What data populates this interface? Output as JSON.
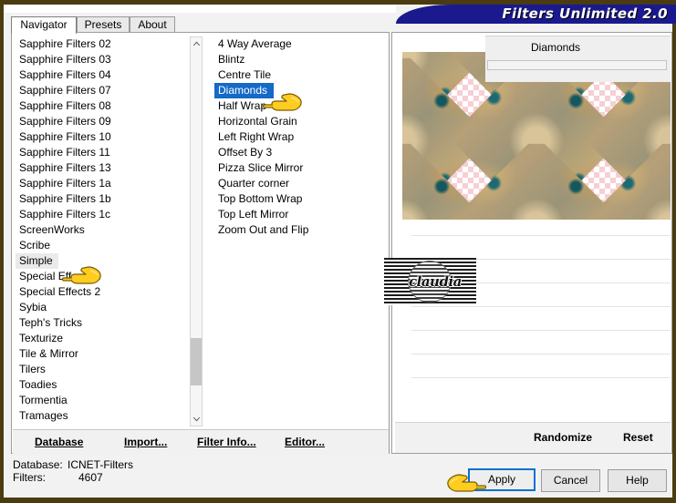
{
  "window": {
    "title": "Filters Unlimited 2.0",
    "frame_color": "#4a3c10",
    "titlebar_color": "#1a1a8e"
  },
  "tabs": [
    {
      "label": "Navigator",
      "active": true
    },
    {
      "label": "Presets",
      "active": false
    },
    {
      "label": "About",
      "active": false
    }
  ],
  "filter_groups": {
    "scroll_thumb_position": "near-bottom",
    "items": [
      {
        "label": "Sapphire Filters 02",
        "selected": false
      },
      {
        "label": "Sapphire Filters 03",
        "selected": false
      },
      {
        "label": "Sapphire Filters 04",
        "selected": false
      },
      {
        "label": "Sapphire Filters 07",
        "selected": false
      },
      {
        "label": "Sapphire Filters 08",
        "selected": false
      },
      {
        "label": "Sapphire Filters 09",
        "selected": false
      },
      {
        "label": "Sapphire Filters 10",
        "selected": false
      },
      {
        "label": "Sapphire Filters 11",
        "selected": false
      },
      {
        "label": "Sapphire Filters 13",
        "selected": false
      },
      {
        "label": "Sapphire Filters 1a",
        "selected": false
      },
      {
        "label": "Sapphire Filters 1b",
        "selected": false
      },
      {
        "label": "Sapphire Filters 1c",
        "selected": false
      },
      {
        "label": "ScreenWorks",
        "selected": false
      },
      {
        "label": "Scribe",
        "selected": false
      },
      {
        "label": "Simple",
        "selected": true
      },
      {
        "label": "Special Effects 1",
        "selected": false
      },
      {
        "label": "Special Effects 2",
        "selected": false
      },
      {
        "label": "Sybia",
        "selected": false
      },
      {
        "label": "Teph's Tricks",
        "selected": false
      },
      {
        "label": "Texturize",
        "selected": false
      },
      {
        "label": "Tile & Mirror",
        "selected": false
      },
      {
        "label": "Tilers",
        "selected": false
      },
      {
        "label": "Toadies",
        "selected": false
      },
      {
        "label": "Tormentia",
        "selected": false
      },
      {
        "label": "Tramages",
        "selected": false
      }
    ]
  },
  "filter_effects": {
    "items": [
      {
        "label": "4 Way Average",
        "selected": false
      },
      {
        "label": "Blintz",
        "selected": false
      },
      {
        "label": "Centre Tile",
        "selected": false
      },
      {
        "label": "Diamonds",
        "selected": true
      },
      {
        "label": "Half Wrap",
        "selected": false
      },
      {
        "label": "Horizontal Grain",
        "selected": false
      },
      {
        "label": "Left Right Wrap",
        "selected": false
      },
      {
        "label": "Offset By 3",
        "selected": false
      },
      {
        "label": "Pizza Slice Mirror",
        "selected": false
      },
      {
        "label": "Quarter corner",
        "selected": false
      },
      {
        "label": "Top Bottom Wrap",
        "selected": false
      },
      {
        "label": "Top Left Mirror",
        "selected": false
      },
      {
        "label": "Zoom Out and Flip",
        "selected": false
      }
    ]
  },
  "group_links": [
    {
      "label": "Database",
      "accel": "D"
    },
    {
      "label": "Import...",
      "accel": "m"
    },
    {
      "label": "Filter Info...",
      "accel": "I"
    },
    {
      "label": "Editor...",
      "accel": "E"
    }
  ],
  "parameters": {
    "logo_text": "claudia",
    "effect_title": "Diamonds",
    "links": [
      {
        "label": "Randomize"
      },
      {
        "label": "Reset"
      }
    ]
  },
  "status": {
    "database_label": "Database:",
    "database_value": "ICNET-Filters",
    "filters_label": "Filters:",
    "filters_value": "4607"
  },
  "buttons": [
    {
      "label": "Apply",
      "primary": true
    },
    {
      "label": "Cancel",
      "primary": false
    },
    {
      "label": "Help",
      "primary": false
    }
  ],
  "cursors": [
    {
      "name": "hand-pointer-effects-list"
    },
    {
      "name": "hand-pointer-groups-list"
    },
    {
      "name": "hand-pointer-apply-button"
    }
  ]
}
